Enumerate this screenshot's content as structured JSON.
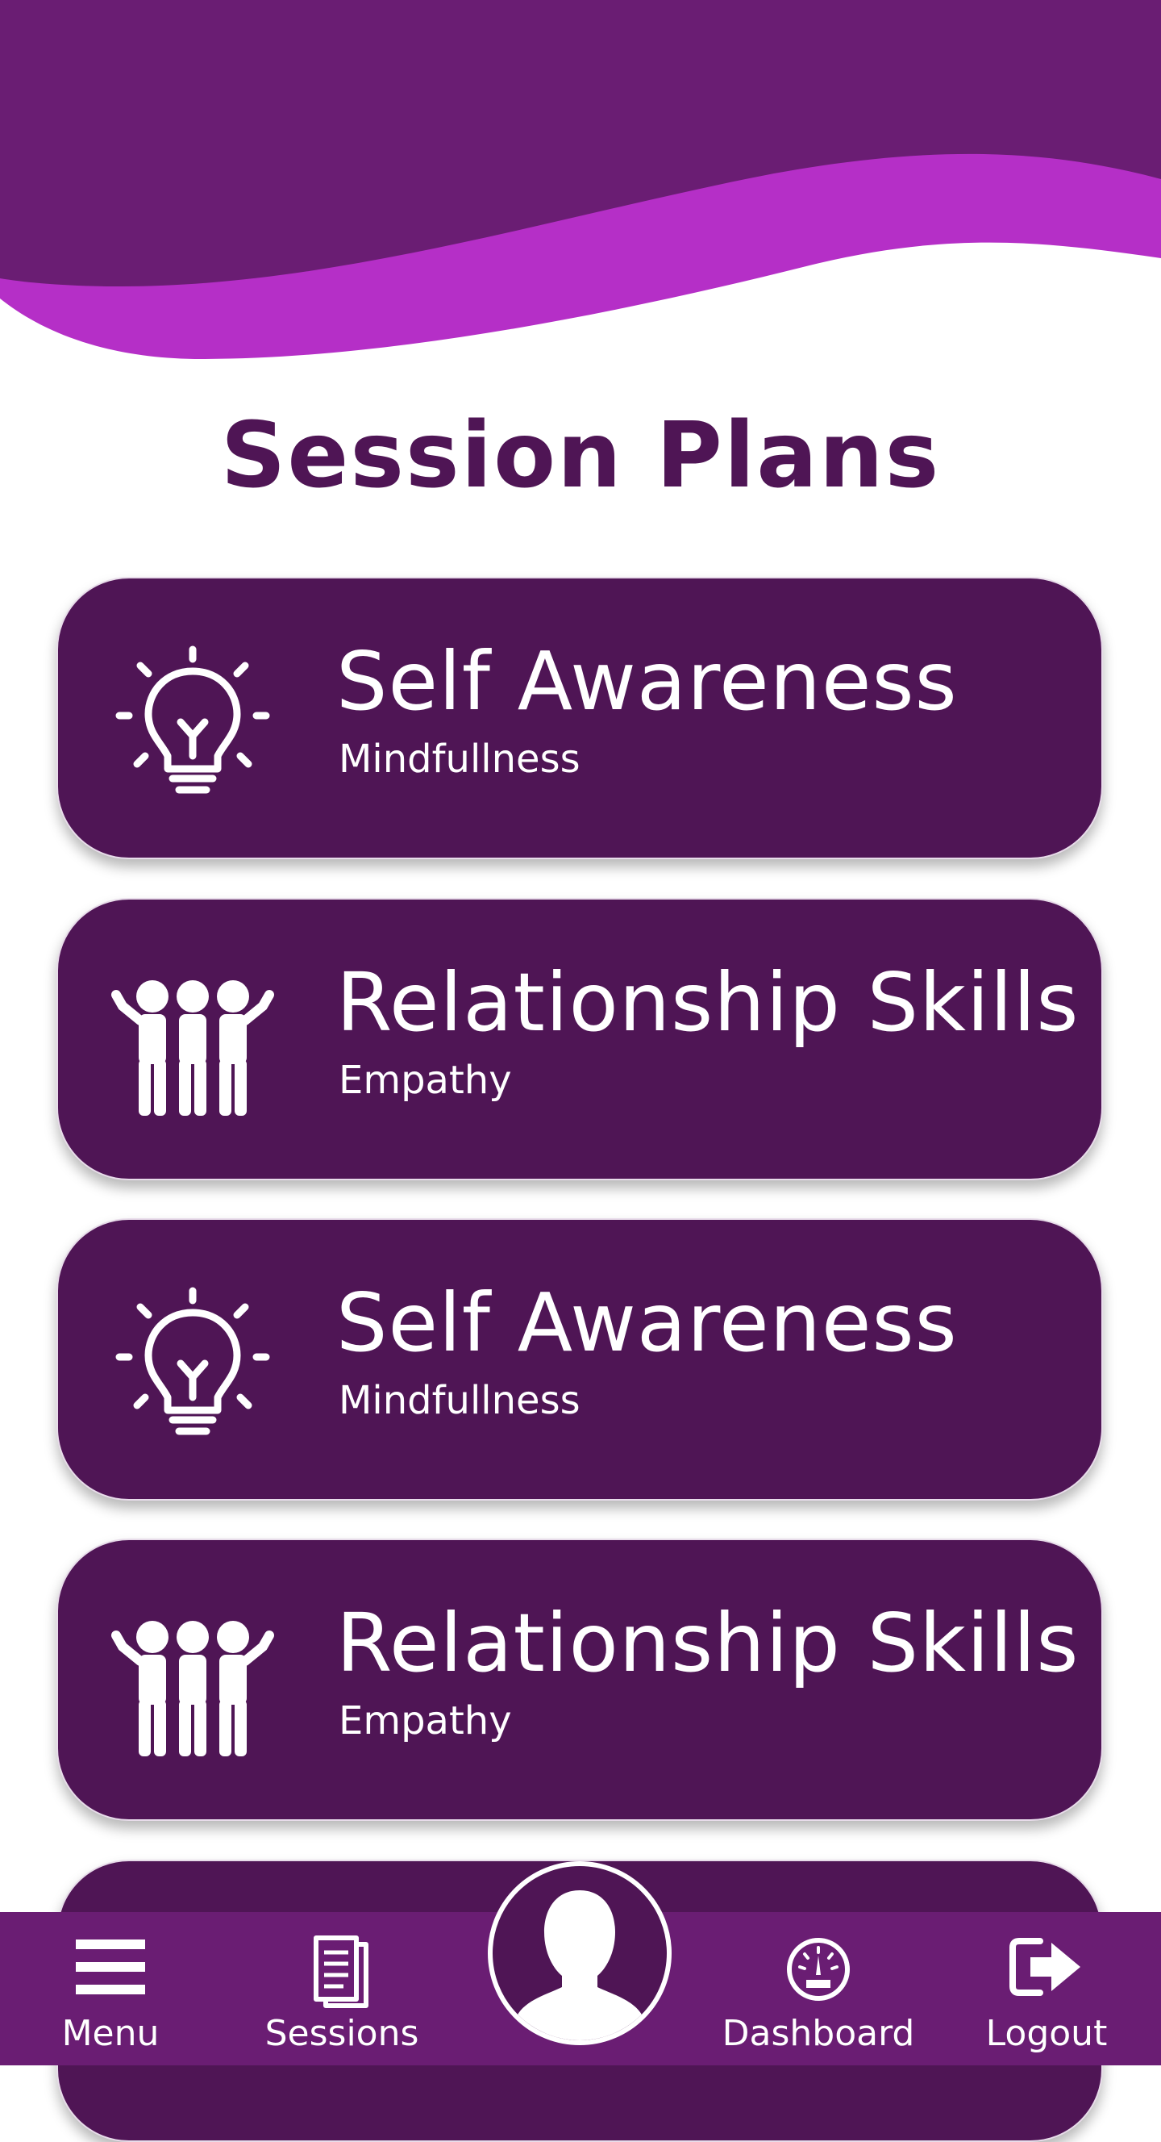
{
  "page": {
    "title": "Session Plans"
  },
  "colors": {
    "dark_purple": "#4f1555",
    "nav_purple": "#6a1d73",
    "wave_magenta": "#b52fc7",
    "white": "#ffffff"
  },
  "cards": [
    {
      "title": "Self Awareness",
      "subtitle": "Mindfullness",
      "icon": "lightbulb-icon"
    },
    {
      "title": "Relationship Skills",
      "subtitle": "Empathy",
      "icon": "people-group-icon"
    },
    {
      "title": "Self Awareness",
      "subtitle": "Mindfullness",
      "icon": "lightbulb-icon"
    },
    {
      "title": "Relationship Skills",
      "subtitle": "Empathy",
      "icon": "people-group-icon"
    }
  ],
  "nav": {
    "items": [
      {
        "label": "Menu",
        "icon": "hamburger-menu-icon"
      },
      {
        "label": "Sessions",
        "icon": "document-icon"
      },
      {
        "label": "",
        "icon": "profile-avatar-icon"
      },
      {
        "label": "Dashboard",
        "icon": "gauge-icon"
      },
      {
        "label": "Logout",
        "icon": "logout-icon"
      }
    ]
  }
}
